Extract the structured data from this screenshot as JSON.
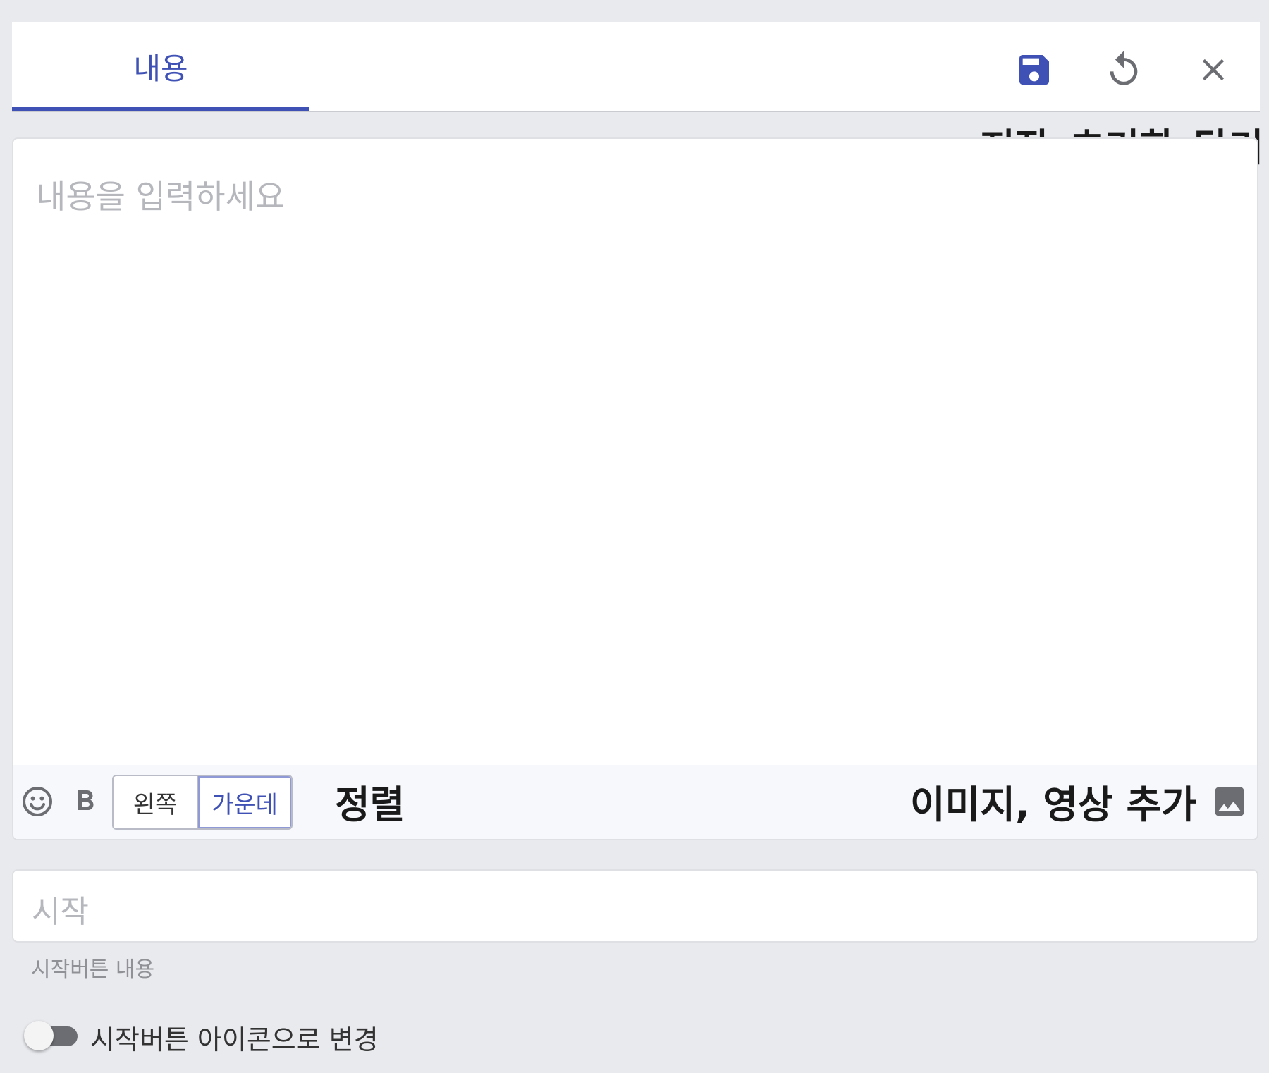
{
  "header": {
    "tab_label": "내용",
    "save_annotation": "저장",
    "reset_annotation": "초기화",
    "close_annotation": "닫기"
  },
  "editor": {
    "placeholder": "내용을 입력하세요",
    "align_annotation": "정렬",
    "align_options": [
      "왼쪽",
      "가운데"
    ],
    "selected_align": "가운데",
    "media_annotation": "이미지, 영상 추가"
  },
  "start_field": {
    "placeholder": "시작",
    "helper": "시작버튼 내용"
  },
  "icon_toggle": {
    "label": "시작버튼 아이콘으로 변경",
    "on": false
  },
  "colors": {
    "accent": "#3f51b5",
    "background": "#e9eaee",
    "icon_gray": "#6b6d72"
  },
  "icons": [
    "save-icon",
    "reset-icon",
    "close-icon",
    "emoji-icon",
    "bold-icon",
    "image-icon"
  ]
}
